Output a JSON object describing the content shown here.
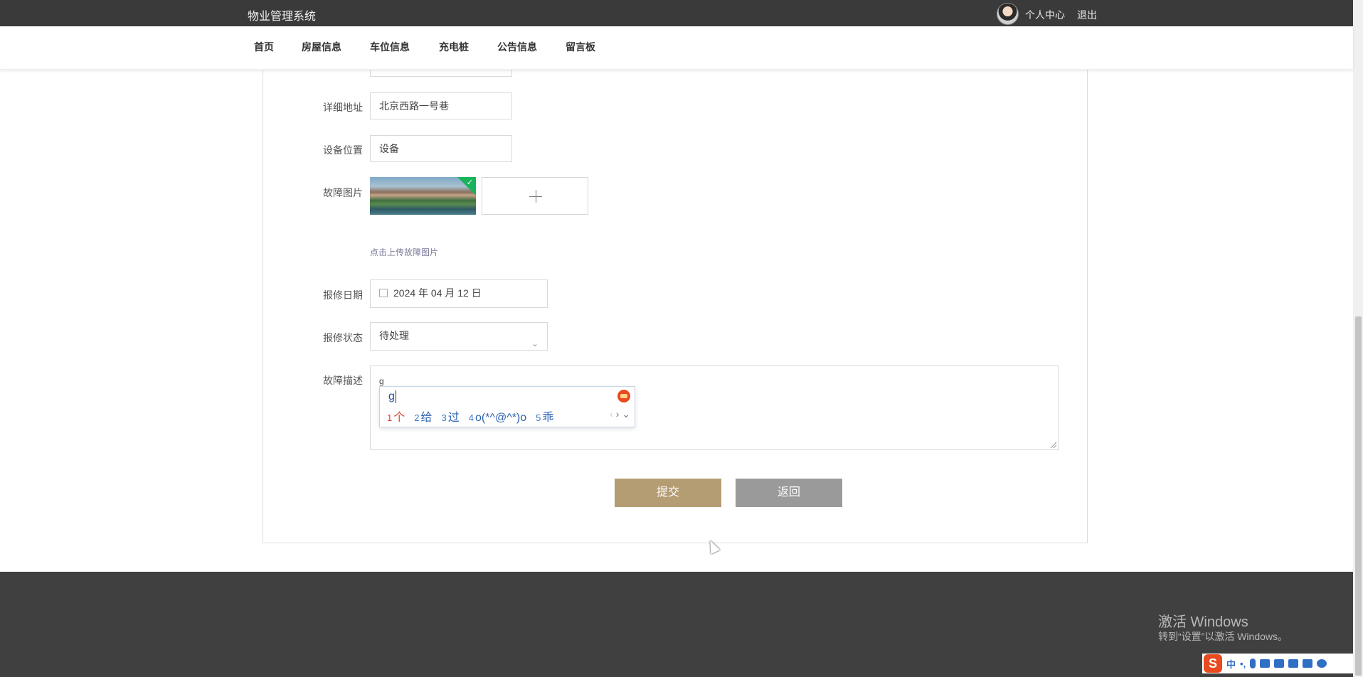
{
  "header": {
    "brand": "物业管理系统",
    "user_center": "个人中心",
    "logout": "退出"
  },
  "nav": {
    "items": [
      "首页",
      "房屋信息",
      "车位信息",
      "充电桩",
      "公告信息",
      "留言板"
    ]
  },
  "form": {
    "address_label": "详细地址",
    "address_value": "北京西路一号巷",
    "location_label": "设备位置",
    "location_value": "设备",
    "image_label": "故障图片",
    "upload_hint": "点击上传故障图片",
    "date_label": "报修日期",
    "date_value": "2024 年 04 月 12 日",
    "status_label": "报修状态",
    "status_value": "待处理",
    "desc_label": "故障描述",
    "desc_value": "g",
    "submit_label": "提交",
    "back_label": "返回"
  },
  "ime": {
    "composition": "g",
    "candidates": [
      {
        "num": "1",
        "text": "个"
      },
      {
        "num": "2",
        "text": "给"
      },
      {
        "num": "3",
        "text": "过"
      },
      {
        "num": "4",
        "text": "o(*^@^*)o"
      },
      {
        "num": "5",
        "text": "乖"
      }
    ],
    "tray_mode": "中"
  },
  "watermark": {
    "line1": "激活 Windows",
    "line2": "转到“设置”以激活 Windows。"
  },
  "colors": {
    "topbar": "#3a3a3a",
    "footer": "#404040",
    "submit": "#b49c73",
    "back": "#9a9a9a",
    "ime_accent": "#2d62b0"
  }
}
